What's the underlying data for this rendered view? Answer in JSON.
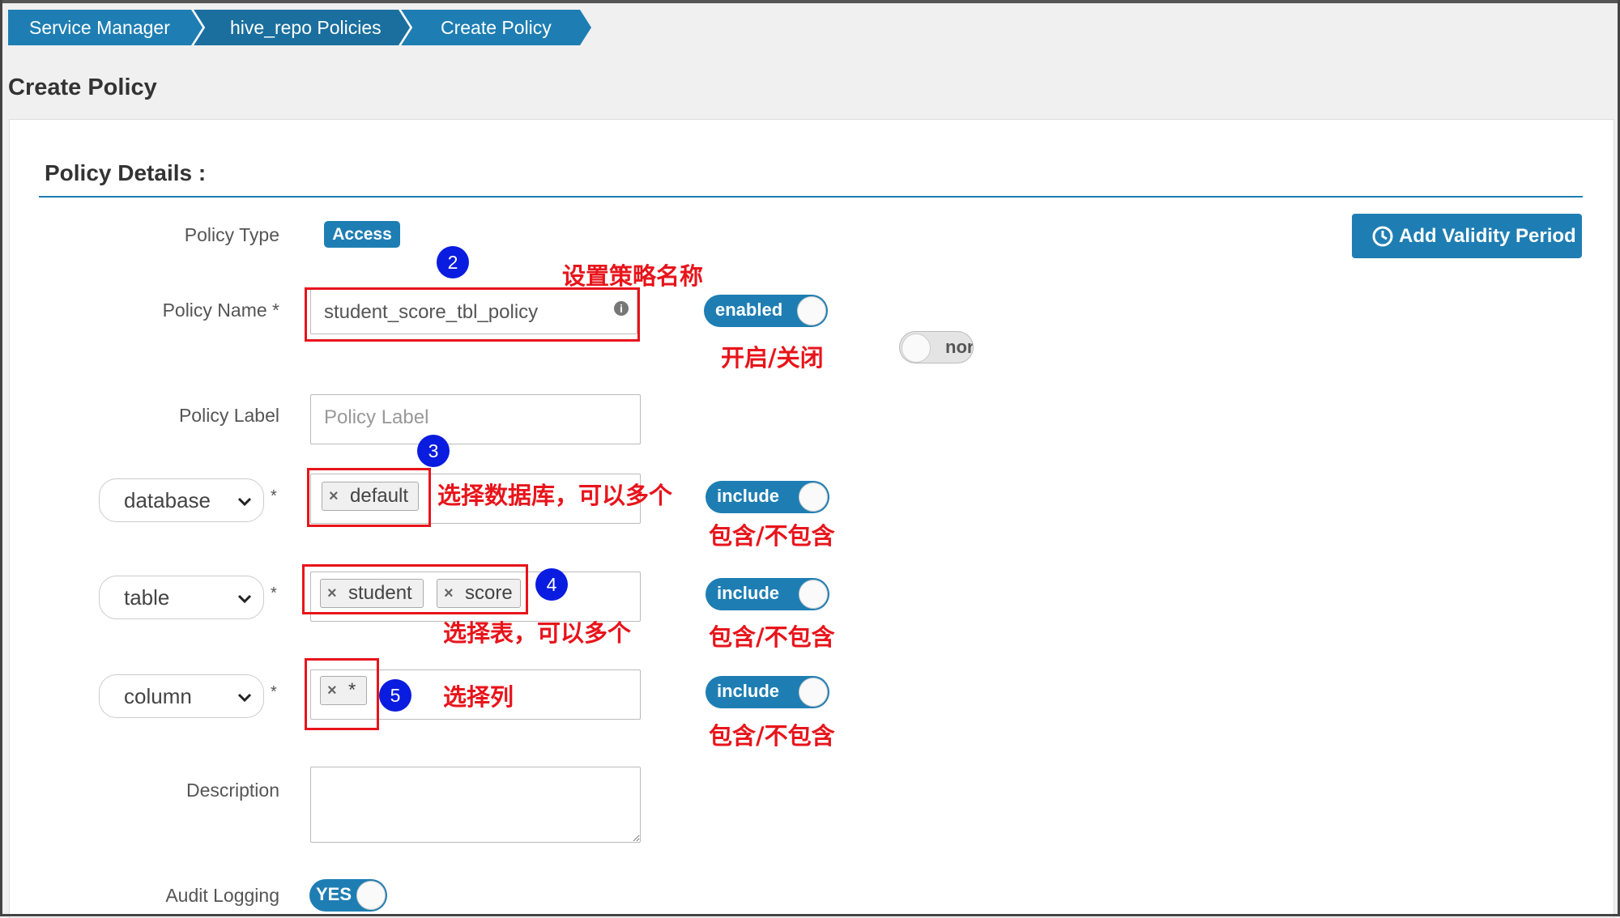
{
  "breadcrumb": {
    "items": [
      {
        "label": "Service Manager"
      },
      {
        "label": "hive_repo Policies"
      },
      {
        "label": "Create Policy"
      }
    ]
  },
  "page": {
    "title": "Create Policy"
  },
  "section": {
    "title": "Policy Details :"
  },
  "policy_type": {
    "label": "Policy Type",
    "value": "Access"
  },
  "validity_button": {
    "label": "Add Validity Period",
    "icon": "clock-icon"
  },
  "policy_name": {
    "label": "Policy Name *",
    "value": "student_score_tbl_policy",
    "info_icon": "i"
  },
  "enabled_toggle": {
    "label": "enabled"
  },
  "normal_toggle": {
    "label": "nor"
  },
  "policy_label": {
    "label": "Policy Label",
    "placeholder": "Policy Label"
  },
  "resources": [
    {
      "type": "database",
      "required": "*",
      "tags": [
        "default"
      ],
      "toggle": "include"
    },
    {
      "type": "table",
      "required": "*",
      "tags": [
        "student",
        "score"
      ],
      "toggle": "include"
    },
    {
      "type": "column",
      "required": "*",
      "tags": [
        "*"
      ],
      "toggle": "include"
    }
  ],
  "description": {
    "label": "Description"
  },
  "audit_logging": {
    "label": "Audit Logging",
    "toggle": "YES"
  },
  "tag_remove_glyph": "×",
  "annotations": {
    "step2": "2",
    "step3": "3",
    "step4": "4",
    "step5": "5",
    "name_note": "设置策略名称",
    "enable_note": "开启/关闭",
    "db_note": "选择数据库，可以多个",
    "db_include_note": "包含/不包含",
    "table_note": "选择表，可以多个",
    "table_include_note": "包含/不包含",
    "column_note": "选择列",
    "column_include_note": "包含/不包含"
  },
  "colors": {
    "accent": "#1e7eb3",
    "annotation_red": "#e8141b",
    "step_circle": "#0a1cdf"
  }
}
